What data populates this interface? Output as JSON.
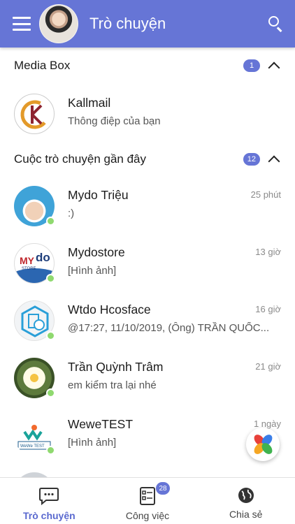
{
  "header": {
    "title": "Trò chuyện"
  },
  "media_box": {
    "title": "Media Box",
    "count": "1",
    "items": [
      {
        "name": "Kallmail",
        "message": "Thông điệp của bạn"
      }
    ]
  },
  "recent": {
    "title": "Cuộc trò chuyện gần đây",
    "count": "12",
    "conversations": [
      {
        "name": "Mydo Triệu",
        "message": ":)",
        "time": "25 phút",
        "online": true
      },
      {
        "name": "Mydostore",
        "message": "[Hình ảnh]",
        "time": "13 giờ",
        "online": true
      },
      {
        "name": "Wtdo Hcosface",
        "message": "@17:27, 11/10/2019, (Ông) TRẦN QUỐC...",
        "time": "16 giờ",
        "online": true
      },
      {
        "name": "Trần Quỳnh Trâm",
        "message": "em kiểm tra lại nhé",
        "time": "21 giờ",
        "online": true
      },
      {
        "name": "WeweTEST",
        "message": "[Hình ảnh]",
        "time": "1 ngày",
        "online": true
      }
    ]
  },
  "avatar_text": {
    "mydo": "MY",
    "do": "do",
    "store": "STORE",
    "wewe": "WeWe TEST"
  },
  "bottom_nav": {
    "items": [
      {
        "label": "Trò chuyện",
        "active": true
      },
      {
        "label": "Công việc",
        "badge": "28"
      },
      {
        "label": "Chia sẻ"
      }
    ]
  },
  "colors": {
    "primary": "#6675d6",
    "online": "#8fd96f"
  },
  "icons": [
    "menu-icon",
    "search-icon",
    "chevron-up-icon",
    "chat-bubble-icon",
    "task-list-icon",
    "globe-icon",
    "app-launcher-icon"
  ]
}
